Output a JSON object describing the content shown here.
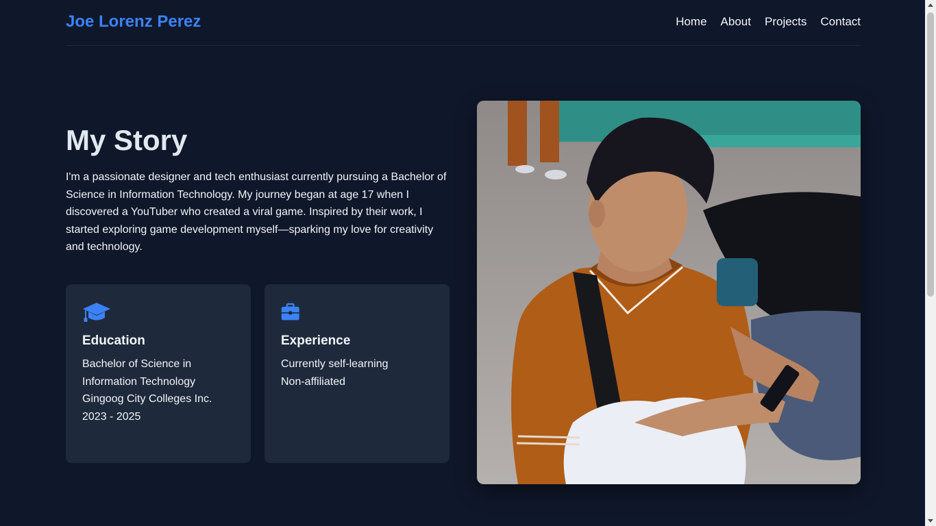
{
  "header": {
    "brand": "Joe Lorenz Perez",
    "nav": [
      "Home",
      "About",
      "Projects",
      "Contact"
    ]
  },
  "story": {
    "title": "My Story",
    "paragraph": "I'm a passionate designer and tech enthusiast currently pursuing a Bachelor of Science in Information Technology. My journey began at age 17 when I discovered a YouTuber who created a viral game. Inspired by their work, I started exploring game development myself—sparking my love for creativity and technology."
  },
  "cards": [
    {
      "icon": "graduation-cap-icon",
      "title": "Education",
      "lines": [
        "Bachelor of Science in Information Technology",
        "Gingoog City Colleges Inc.",
        "2023 - 2025"
      ]
    },
    {
      "icon": "briefcase-icon",
      "title": "Experience",
      "lines": [
        "Currently self-learning",
        "Non-affiliated"
      ]
    }
  ],
  "photo": {
    "icon": "profile-photo"
  },
  "colors": {
    "background": "#0f172a",
    "card": "#1e293b",
    "accent": "#3b82f6",
    "text": "#f1f5f9"
  }
}
